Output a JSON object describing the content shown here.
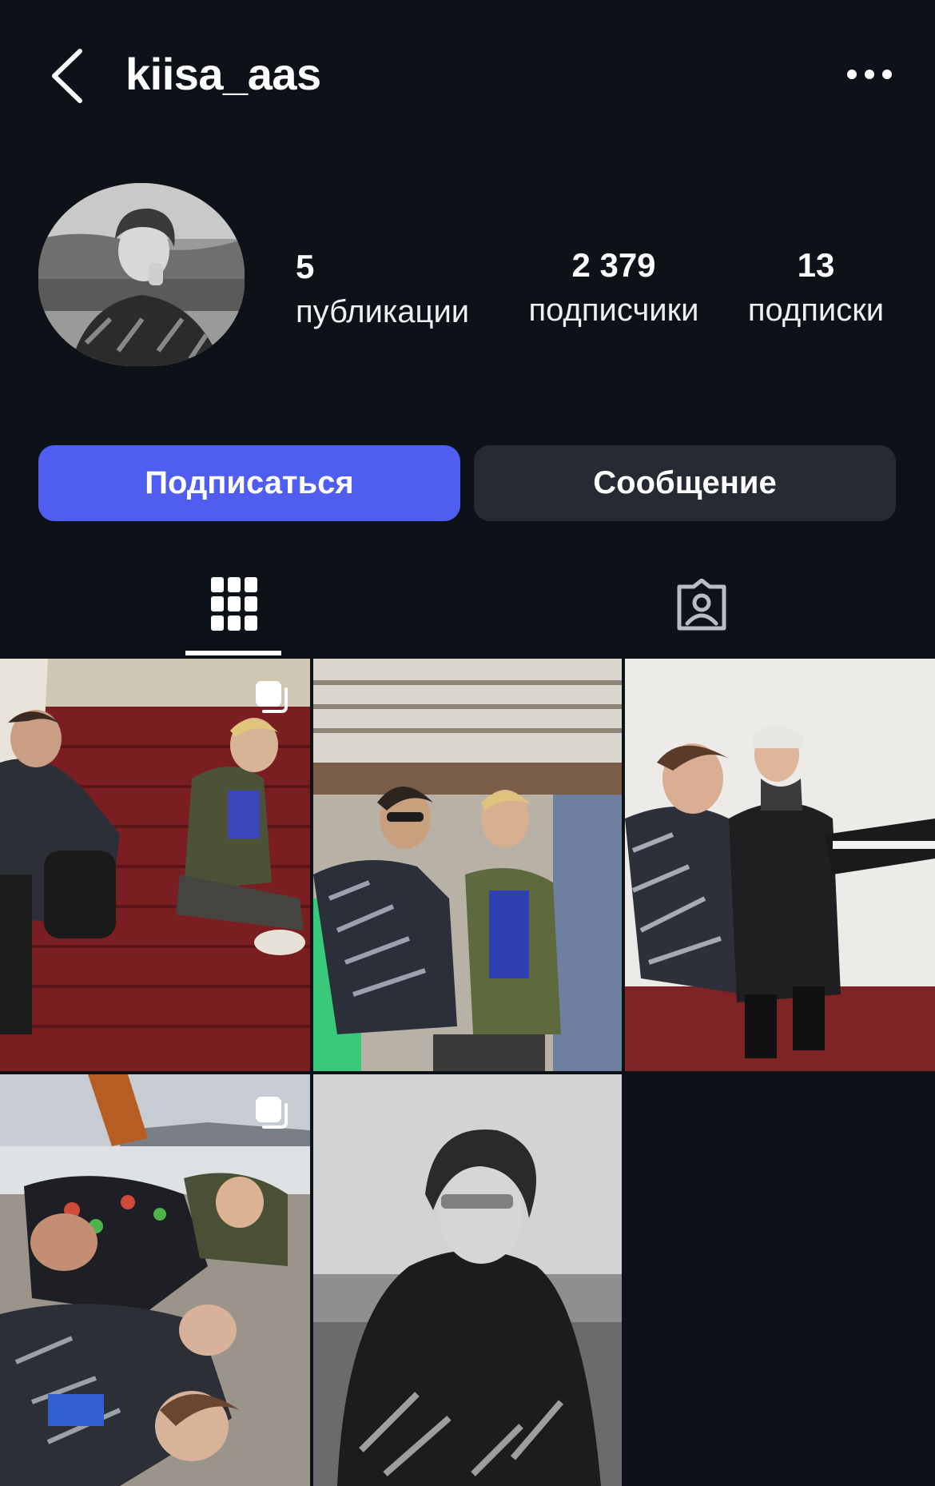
{
  "header": {
    "username": "kiisa_aas",
    "back_icon": "chevron-left-icon",
    "more_icon": "ellipsis-icon"
  },
  "stats": {
    "posts": {
      "value": "5",
      "label": "публикации"
    },
    "followers": {
      "value": "2 379",
      "label": "подписчики"
    },
    "following": {
      "value": "13",
      "label": "подписки"
    }
  },
  "actions": {
    "follow_label": "Подписаться",
    "message_label": "Сообщение"
  },
  "tabs": [
    {
      "name": "grid-icon",
      "active": true
    },
    {
      "name": "tagged-icon",
      "active": false
    }
  ],
  "posts": [
    {
      "description": "group on red carpeted stairs",
      "multi": true
    },
    {
      "description": "two people under a roof, smoking",
      "multi": false
    },
    {
      "description": "group hugging in front of white wall",
      "multi": false
    },
    {
      "description": "group lying on a beach",
      "multi": true
    },
    {
      "description": "black and white portrait at sea",
      "multi": false
    }
  ],
  "colors": {
    "background": "#0d1118",
    "follow_button": "#4f5ef0",
    "message_button": "#262a33",
    "text": "#ffffff"
  }
}
